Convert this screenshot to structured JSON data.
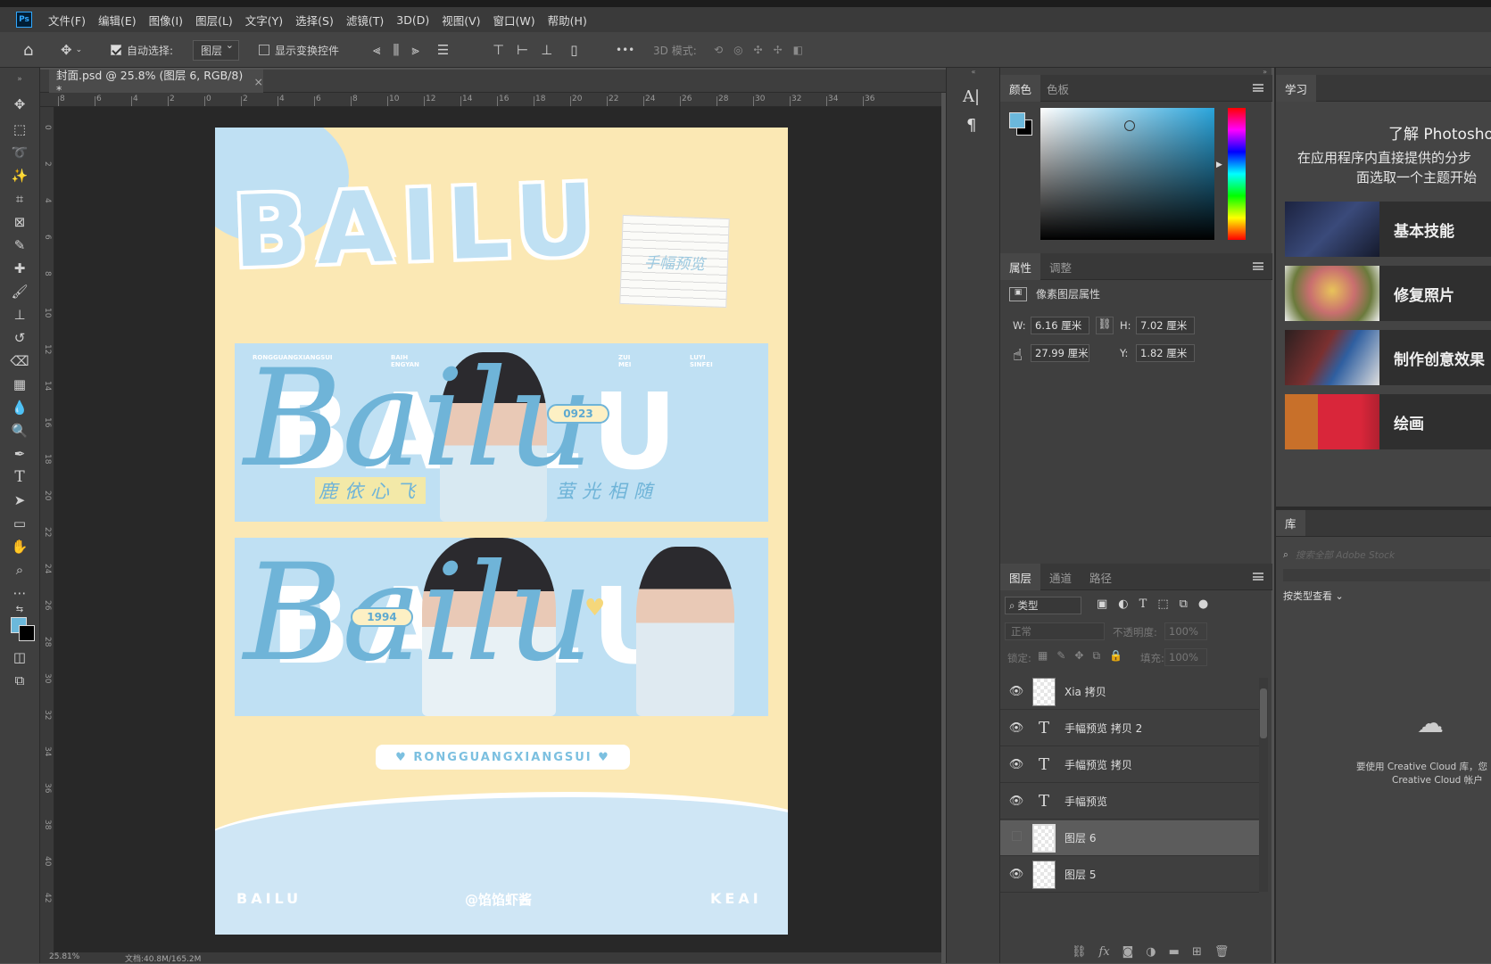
{
  "menubar": {
    "logo": "Ps",
    "items": [
      "文件(F)",
      "编辑(E)",
      "图像(I)",
      "图层(L)",
      "文字(Y)",
      "选择(S)",
      "滤镜(T)",
      "3D(D)",
      "视图(V)",
      "窗口(W)",
      "帮助(H)"
    ]
  },
  "options": {
    "auto_select_label": "自动选择:",
    "auto_select_value": "图层",
    "show_transform_label": "显示变换控件",
    "more": "•••",
    "mode3d": "3D 模式:"
  },
  "document": {
    "tab_title": "封面.psd @ 25.8% (图层 6, RGB/8) *",
    "close": "×"
  },
  "status": {
    "zoom": "25.81%",
    "doc_size": "文档:40.8M/165.2M"
  },
  "ruler": {
    "h_ticks": [
      "8",
      "6",
      "4",
      "2",
      "0",
      "2",
      "4",
      "6",
      "8",
      "10",
      "12",
      "14",
      "16",
      "18",
      "20",
      "22",
      "24",
      "26",
      "28",
      "30",
      "32",
      "34",
      "36"
    ],
    "v_ticks": [
      "0",
      "2",
      "4",
      "6",
      "8",
      "10",
      "12",
      "14",
      "16",
      "18",
      "20",
      "22",
      "24",
      "26",
      "28",
      "30",
      "32",
      "34",
      "36",
      "38",
      "40",
      "42"
    ]
  },
  "artwork": {
    "title_word": "BAILU",
    "note_text": "手幅预览",
    "banner1": {
      "labels": [
        "RONGGUANGXIANGSUI",
        "BAIH ENGYAN",
        "ZUI MEI",
        "LUYI SINFEI"
      ],
      "big": "BAILU",
      "script": "Bailu",
      "date": "0923",
      "caption_left": "鹿依心飞",
      "caption_right": "萤光相随"
    },
    "banner2": {
      "big": "BAILU",
      "script": "Bailu",
      "date": "1994"
    },
    "pill": "♥ RONGGUANGXIANGSUI ♥",
    "footer_left": "BAILU",
    "footer_center": "@馅馅虾酱",
    "footer_right": "KEAI"
  },
  "colors": {
    "foreground": "#6bb8db",
    "background": "#000000"
  },
  "color_panel": {
    "tabs": [
      "颜色",
      "色板"
    ]
  },
  "properties": {
    "tabs": [
      "属性",
      "调整"
    ],
    "title": "像素图层属性",
    "w_label": "W:",
    "w": "6.16 厘米",
    "h_label": "H:",
    "h": "7.02 厘米",
    "x": "27.99 厘米",
    "y_label": "Y:",
    "y": "1.82 厘米"
  },
  "layers_panel": {
    "tabs": [
      "图层",
      "通道",
      "路径"
    ],
    "filter": "类型",
    "blend": "正常",
    "opacity_label": "不透明度:",
    "opacity": "100%",
    "lock_label": "锁定:",
    "fill_label": "填充:",
    "fill": "100%",
    "layers": [
      {
        "name": "Xia 拷贝",
        "kind": "pixel",
        "visible": true,
        "selected": false
      },
      {
        "name": "手幅预览 拷贝 2",
        "kind": "text",
        "visible": true,
        "selected": false
      },
      {
        "name": "手幅预览 拷贝",
        "kind": "text",
        "visible": true,
        "selected": false
      },
      {
        "name": "手幅预览",
        "kind": "text",
        "visible": true,
        "selected": false
      },
      {
        "name": "图层 6",
        "kind": "pixel",
        "visible": false,
        "selected": true
      },
      {
        "name": "图层 5",
        "kind": "pixel",
        "visible": true,
        "selected": false
      }
    ]
  },
  "learn": {
    "tab": "学习",
    "heading": "了解 Photoshop",
    "sub1": "在应用程序内直接提供的分步",
    "sub2": "面选取一个主题开始",
    "cards": [
      "基本技能",
      "修复照片",
      "制作创意效果",
      "绘画"
    ]
  },
  "library": {
    "tab": "库",
    "search_placeholder": "搜索全部 Adobe Stock",
    "view_by": "按类型查看",
    "cc_line1": "要使用 Creative Cloud 库，您",
    "cc_line2": "Creative Cloud 帐户"
  }
}
